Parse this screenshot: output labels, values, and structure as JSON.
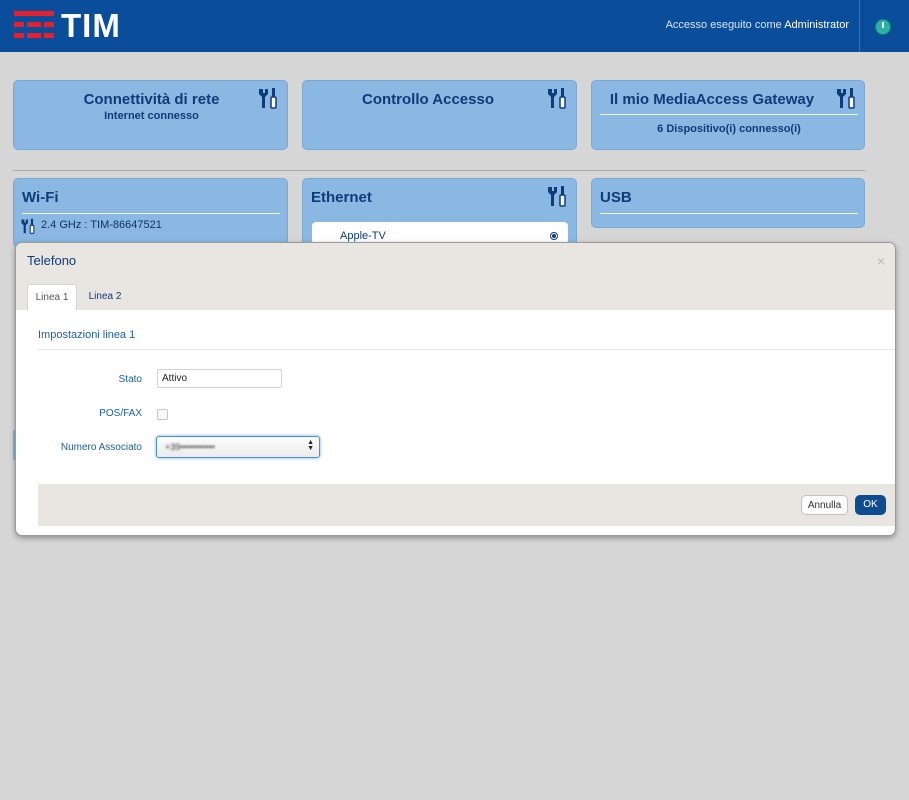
{
  "header": {
    "logo_text": "TIM",
    "login_prefix": "Accesso eseguito come",
    "login_user": "Administrator",
    "colors": {
      "bar": "#0a4d9a",
      "logo_red": "#e8202b"
    }
  },
  "cards": {
    "connectivity": {
      "title": "Connettività di rete",
      "subtitle": "Internet connesso"
    },
    "access_control": {
      "title": "Controllo Accesso"
    },
    "gateway": {
      "title": "Il mio MediaAccess Gateway",
      "subtitle": "6 Dispositivo(i) connesso(i)"
    },
    "wifi": {
      "title": "Wi-Fi",
      "line": "2.4 GHz : TIM-86647521"
    },
    "ethernet": {
      "title": "Ethernet",
      "item": "Apple-TV"
    },
    "usb": {
      "title": "USB"
    }
  },
  "modal": {
    "title": "Telefono",
    "close": "×",
    "tabs": [
      {
        "label": "Linea 1",
        "active": true
      },
      {
        "label": "Linea 2",
        "active": false
      }
    ],
    "section": "Impostazioni linea 1",
    "fields": {
      "stato": {
        "label": "Stato",
        "value": "Attivo"
      },
      "posfax": {
        "label": "POS/FAX",
        "checked": false
      },
      "numero": {
        "label": "Numero Associato",
        "value": "+39•••••••••••"
      }
    },
    "buttons": {
      "cancel": "Annulla",
      "ok": "OK"
    }
  }
}
